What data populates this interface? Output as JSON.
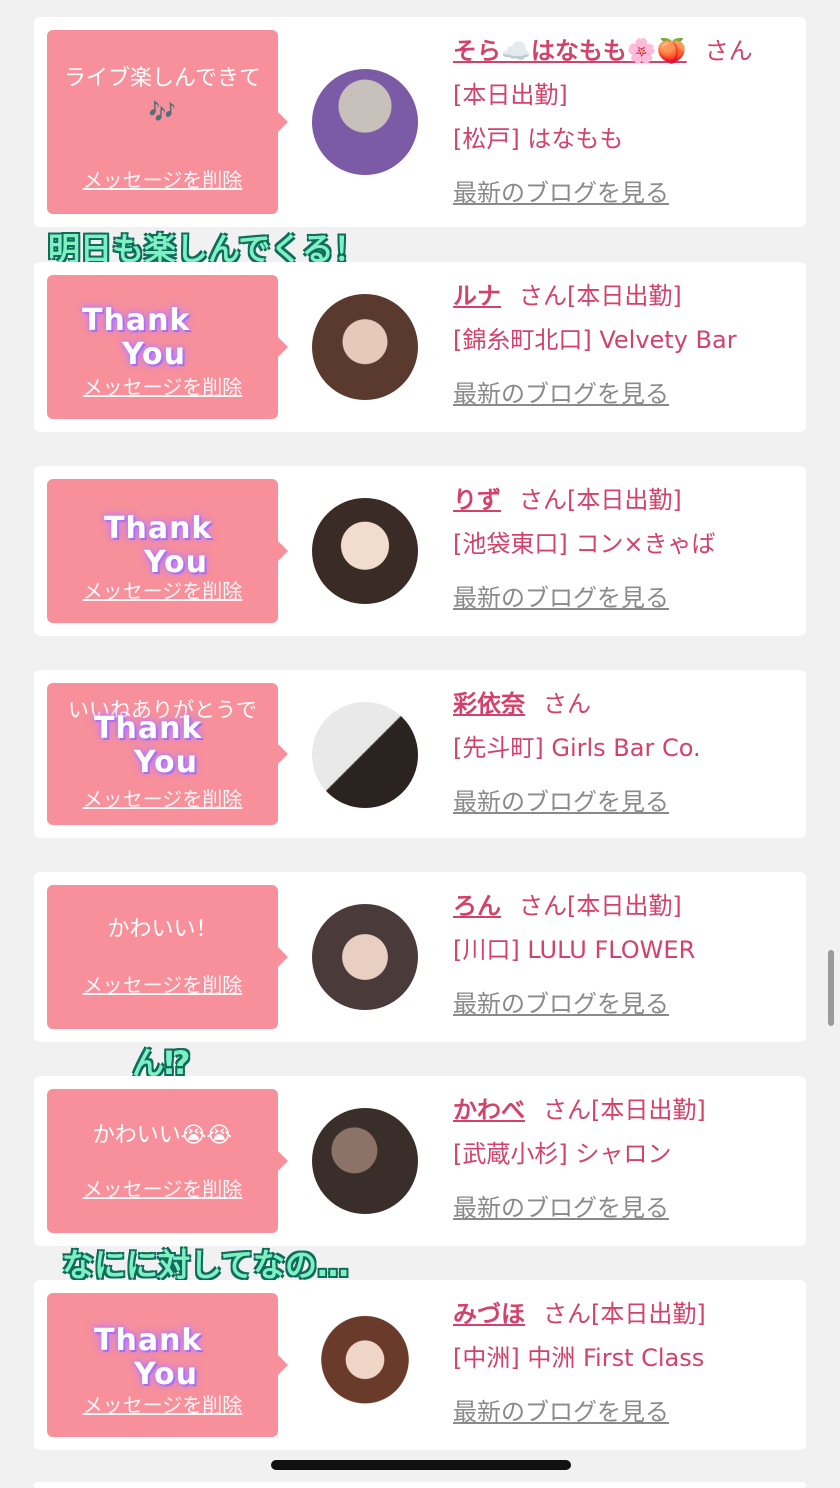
{
  "colors": {
    "accent": "#d2426b",
    "bubble": "#f7909a",
    "background": "#f1f1f1",
    "caption": "#7ff0c2"
  },
  "captions": {
    "c1": "明日も楽しんでくる！",
    "c2": "ん⁉",
    "c3": "なにに対してなの…"
  },
  "overlay": {
    "thank": "Thank",
    "you": "You"
  },
  "cards": [
    {
      "message": "ライブ楽しんできて🎶",
      "delete_label": "メッセージを削除",
      "name": "そら☁️はなもも🌸🍑",
      "suffix": "さん[本日出勤]",
      "shop": "[松戸] はなもも",
      "blog": "最新のブログを見る",
      "avatar": "avatar-photo"
    },
    {
      "message": "",
      "delete_label": "メッセージを削除",
      "name": "ルナ",
      "suffix": "さん[本日出勤]",
      "shop": "[錦糸町北口] Velvety Bar",
      "blog": "最新のブログを見る",
      "avatar": "avatar-photo"
    },
    {
      "message": "",
      "delete_label": "メッセージを削除",
      "name": "りず",
      "suffix": "さん[本日出勤]",
      "shop": "[池袋東口] コン×きゃば",
      "blog": "最新のブログを見る",
      "avatar": "avatar-photo"
    },
    {
      "message": "いいねありがとうで",
      "delete_label": "メッセージを削除",
      "name": "彩依奈",
      "suffix": "さん",
      "shop": "[先斗町] Girls Bar Co.",
      "blog": "最新のブログを見る",
      "avatar": "avatar-photo"
    },
    {
      "message": "かわいい！",
      "delete_label": "メッセージを削除",
      "name": "ろん",
      "suffix": "さん[本日出勤]",
      "shop": "[川口] LULU FLOWER",
      "blog": "最新のブログを見る",
      "avatar": "avatar-photo"
    },
    {
      "message": "かわいい😭😭",
      "delete_label": "メッセージを削除",
      "name": "かわべ",
      "suffix": "さん[本日出勤]",
      "shop": "[武蔵小杉] シャロン",
      "blog": "最新のブログを見る",
      "avatar": "avatar-photo"
    },
    {
      "message": "",
      "delete_label": "メッセージを削除",
      "name": "みづほ",
      "suffix": "さん[本日出勤]",
      "shop": "[中洲] 中洲 First Class",
      "blog": "最新のブログを見る",
      "avatar": "avatar-photo"
    }
  ]
}
